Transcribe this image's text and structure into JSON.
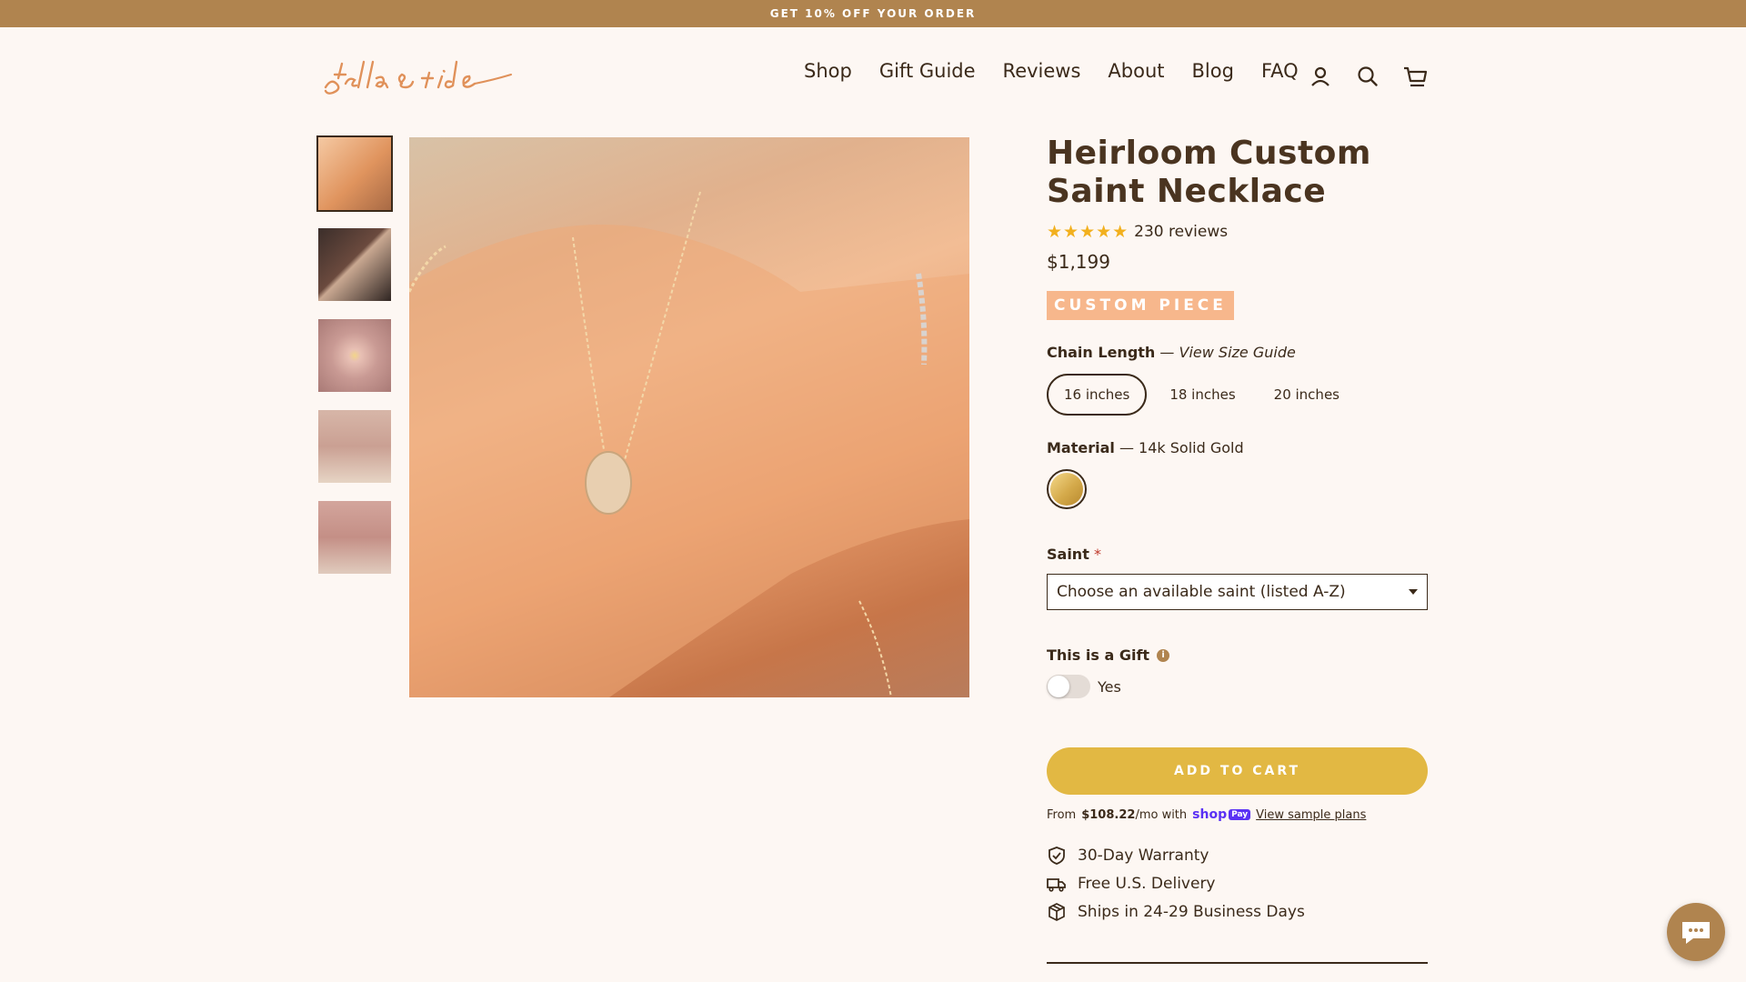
{
  "announcement": "GET 10% OFF YOUR ORDER",
  "brand": {
    "logo_text": "stella & tide"
  },
  "nav": {
    "items": [
      "Shop",
      "Gift Guide",
      "Reviews",
      "About",
      "Blog",
      "FAQ"
    ],
    "icons": [
      "account-icon",
      "search-icon",
      "cart-icon"
    ]
  },
  "gallery": {
    "thumbnail_count": 5,
    "active_index": 0
  },
  "product": {
    "title": "Heirloom Custom Saint Necklace",
    "rating_stars": "★★★★★",
    "rating": 5,
    "reviews": "230 reviews",
    "price": "$1,199",
    "badge": "CUSTOM PIECE",
    "chain": {
      "label": "Chain Length",
      "sep": "—",
      "guide": "View Size Guide",
      "options": [
        "16 inches",
        "18 inches",
        "20 inches"
      ],
      "selected": "16 inches"
    },
    "material": {
      "label": "Material",
      "value": "— 14k Solid Gold",
      "swatch_color": "#d4a94a"
    },
    "saint": {
      "label": "Saint",
      "required": "*",
      "selected": "Choose an available saint (listed A-Z)"
    },
    "gift": {
      "label": "This is a Gift",
      "info": "i",
      "toggle_label": "Yes",
      "on": false
    },
    "add_to_cart": "ADD TO CART",
    "installments": {
      "prefix": "From",
      "amount": "$108.22",
      "suffix": "/mo with",
      "provider": "shop",
      "provider_tag": "Pay",
      "link": "View sample plans"
    },
    "perks": [
      "30-Day Warranty",
      "Free U.S. Delivery",
      "Ships in 24-29 Business Days"
    ]
  },
  "colors": {
    "accent": "#b0844f",
    "cart": "#e2b843",
    "badge": "#f7b78c",
    "background": "#fdf7f3"
  }
}
